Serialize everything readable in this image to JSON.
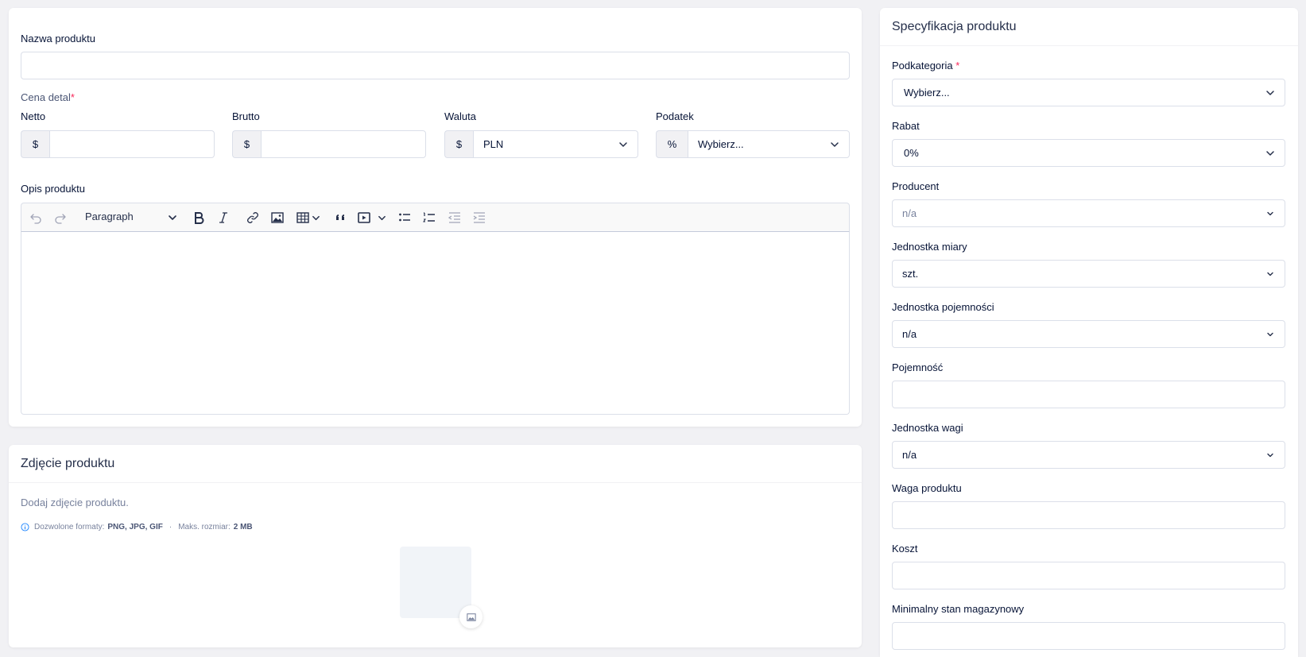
{
  "product_form": {
    "name_label": "Nazwa produktu",
    "name_value": "",
    "retail_price_label": "Cena detal",
    "retail_price_required": "*",
    "net_label": "Netto",
    "net_addon": "$",
    "gross_label": "Brutto",
    "gross_addon": "$",
    "currency_label": "Waluta",
    "currency_addon": "$",
    "currency_value": "PLN",
    "tax_label": "Podatek",
    "tax_addon": "%",
    "tax_value": "Wybierz...",
    "description_label": "Opis produktu",
    "editor_style": "Paragraph"
  },
  "photo_card": {
    "title": "Zdjęcie produktu",
    "instruction": "Dodaj zdjęcie produktu.",
    "formats_prefix": "Dozwolone formaty:",
    "formats_value": "PNG, JPG, GIF",
    "separator": "·",
    "max_size_prefix": "Maks. rozmiar:",
    "max_size_value": "2 MB"
  },
  "spec_card": {
    "title": "Specyfikacja produktu",
    "subcategory_label": "Podkategoria",
    "subcategory_required": "*",
    "subcategory_value": "Wybierz...",
    "discount_label": "Rabat",
    "discount_value": "0%",
    "producer_label": "Producent",
    "producer_value": "n/a",
    "unit_label": "Jednostka miary",
    "unit_value": "szt.",
    "capacity_unit_label": "Jednostka pojemności",
    "capacity_unit_value": "n/a",
    "capacity_label": "Pojemność",
    "weight_unit_label": "Jednostka wagi",
    "weight_unit_value": "n/a",
    "weight_label": "Waga produktu",
    "cost_label": "Koszt",
    "min_stock_label": "Minimalny stan magazynowy"
  },
  "colors": {
    "page_bg": "#f1f1f4",
    "required": "#f8285a",
    "border": "#dbdfe9",
    "text": "#071437",
    "muted": "#78829d"
  }
}
